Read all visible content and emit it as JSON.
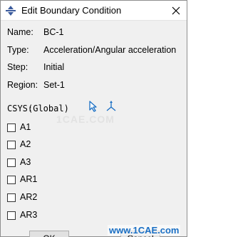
{
  "window": {
    "title": "Edit Boundary Condition",
    "icon": "boundary-condition-icon",
    "close_icon": "close-icon"
  },
  "fields": {
    "name_label": "Name:",
    "name_value": "BC-1",
    "type_label": "Type:",
    "type_value": "Acceleration/Angular acceleration",
    "step_label": "Step:",
    "step_value": "Initial",
    "region_label": "Region:",
    "region_value": "Set-1"
  },
  "csys": {
    "label": "CSYS:",
    "value": "(Global)",
    "pick_icon": "arrow-pointer-icon",
    "axes_icon": "coordinate-axes-icon"
  },
  "dofs": [
    {
      "label": "A1",
      "checked": false
    },
    {
      "label": "A2",
      "checked": false
    },
    {
      "label": "A3",
      "checked": false
    },
    {
      "label": "AR1",
      "checked": false
    },
    {
      "label": "AR2",
      "checked": false
    },
    {
      "label": "AR3",
      "checked": false
    }
  ],
  "buttons": {
    "ok_label": "OK",
    "cancel_label": "Cancel"
  },
  "watermarks": {
    "center": "1CAE.COM",
    "bottom": "www.1CAE.com"
  },
  "colors": {
    "accent": "#1a6fc4",
    "window_bg": "#f0f0f0"
  }
}
